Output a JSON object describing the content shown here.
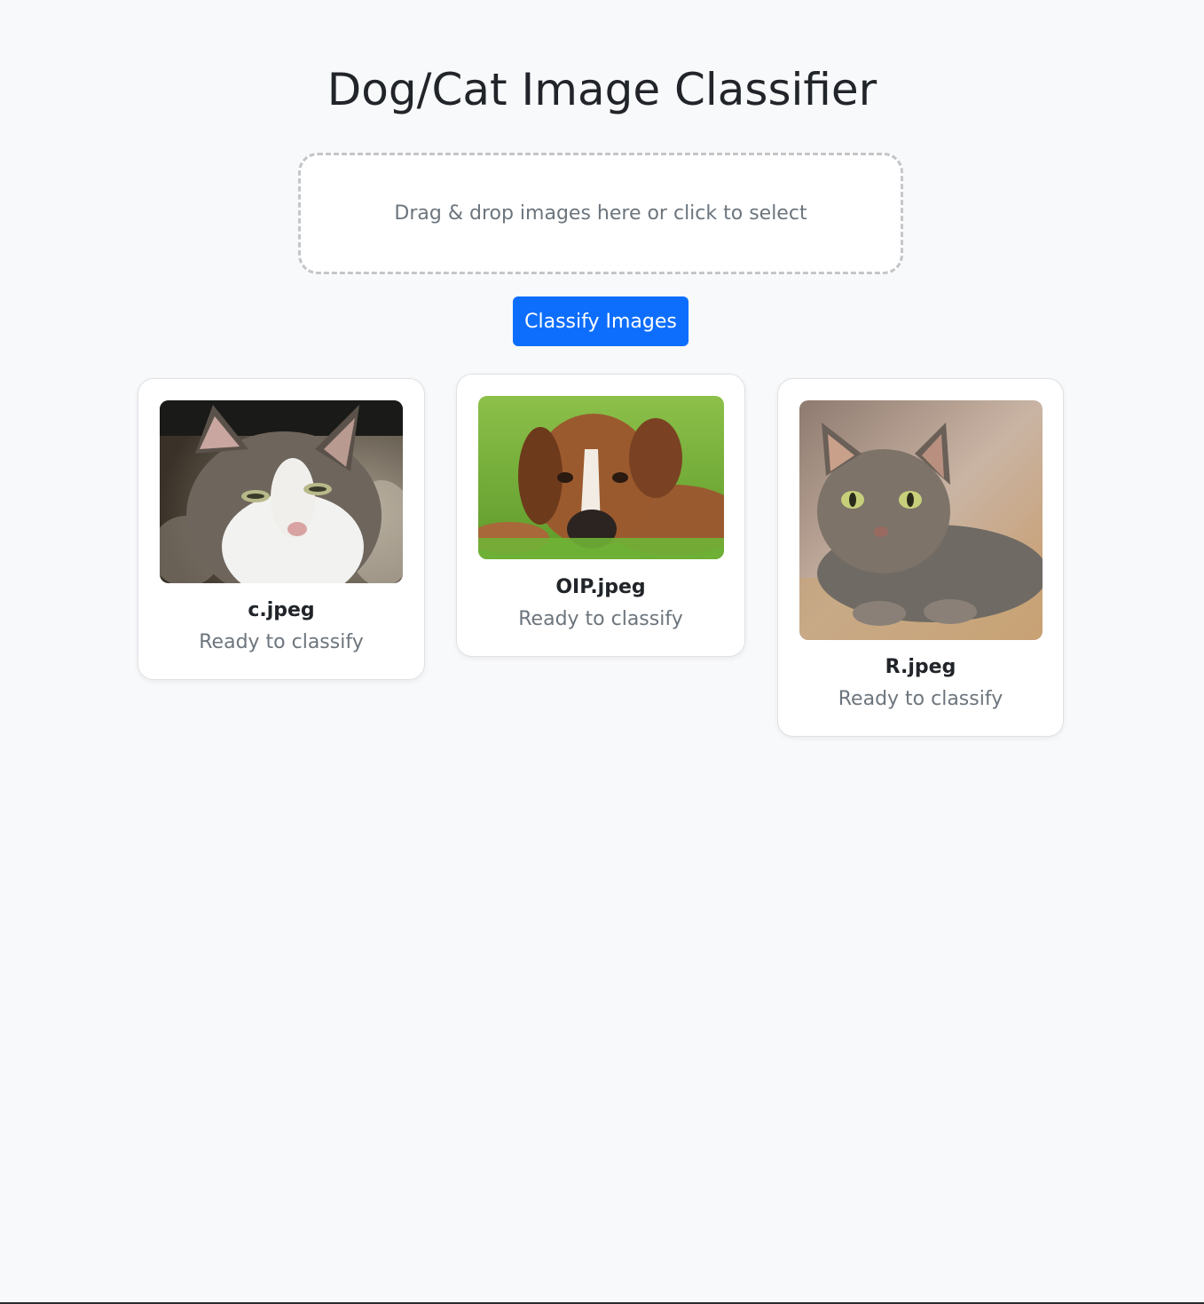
{
  "page": {
    "title": "Dog/Cat Image Classifier"
  },
  "upload": {
    "drop_text": "Drag & drop images here or click to select"
  },
  "actions": {
    "classify_label": "Classify Images"
  },
  "images": [
    {
      "filename": "c.jpeg",
      "status": "Ready to classify",
      "subject": "cat-photo"
    },
    {
      "filename": "OIP.jpeg",
      "status": "Ready to classify",
      "subject": "dog-photo"
    },
    {
      "filename": "R.jpeg",
      "status": "Ready to classify",
      "subject": "cat-photo"
    }
  ],
  "colors": {
    "background": "#f8f9fa",
    "primary": "#0d6efd",
    "muted_text": "#6c757d",
    "text": "#212529"
  }
}
